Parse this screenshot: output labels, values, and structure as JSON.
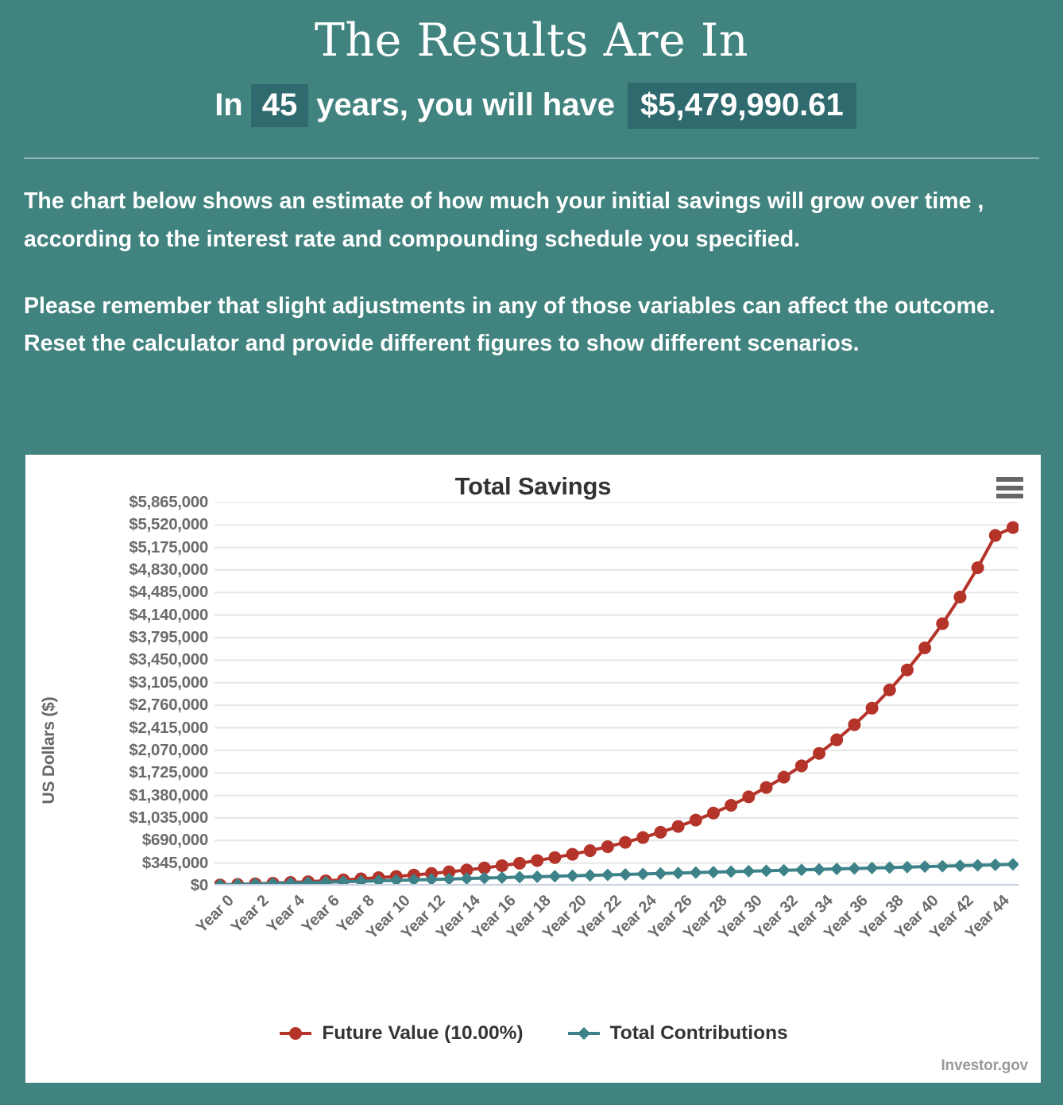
{
  "header": {
    "title": "The Results Are In",
    "in_word": "In",
    "years": "45",
    "years_word": "years, you will have",
    "amount": "$5,479,990.61"
  },
  "body": {
    "paragraph_1": "The chart below shows an estimate of how much your initial savings will grow over time , according to the interest rate and compounding schedule you specified.",
    "paragraph_2": "Please remember that slight adjustments in any of those variables can affect the outcome. Reset the calculator and provide different figures to show different scenarios."
  },
  "chart": {
    "title": "Total Savings",
    "menu_icon": "hamburger-menu-icon",
    "watermark": "Investor.gov"
  },
  "colors": {
    "page_background": "#41837f",
    "highlight_box": "#2f6a6e",
    "future_value": "#b5342a",
    "total_contributions": "#3d8289",
    "gridline": "#e6e6e6",
    "axis_text": "#6b6b6b",
    "card_background": "#ffffff"
  },
  "chart_data": {
    "type": "line",
    "title": "Total Savings",
    "xlabel": "",
    "ylabel": "US Dollars ($)",
    "ylim": [
      0,
      5865000
    ],
    "grid": true,
    "legend_position": "bottom",
    "y_ticks": [
      "$0",
      "$345,000",
      "$690,000",
      "$1,035,000",
      "$1,380,000",
      "$1,725,000",
      "$2,070,000",
      "$2,415,000",
      "$2,760,000",
      "$3,105,000",
      "$3,450,000",
      "$3,795,000",
      "$4,140,000",
      "$4,485,000",
      "$4,830,000",
      "$5,175,000",
      "$5,520,000",
      "$5,865,000"
    ],
    "y_tick_values": [
      0,
      345000,
      690000,
      1035000,
      1380000,
      1725000,
      2070000,
      2415000,
      2760000,
      3105000,
      3450000,
      3795000,
      4140000,
      4485000,
      4830000,
      5175000,
      5520000,
      5865000
    ],
    "x_tick_labels": [
      "Year 0",
      "Year 2",
      "Year 4",
      "Year 6",
      "Year 8",
      "Year 10",
      "Year 12",
      "Year 14",
      "Year 16",
      "Year 18",
      "Year 20",
      "Year 22",
      "Year 24",
      "Year 26",
      "Year 28",
      "Year 30",
      "Year 32",
      "Year 34",
      "Year 36",
      "Year 38",
      "Year 40",
      "Year 42",
      "Year 44"
    ],
    "x": [
      0,
      1,
      2,
      3,
      4,
      5,
      6,
      7,
      8,
      9,
      10,
      11,
      12,
      13,
      14,
      15,
      16,
      17,
      18,
      19,
      20,
      21,
      22,
      23,
      24,
      25,
      26,
      27,
      28,
      29,
      30,
      31,
      32,
      33,
      34,
      35,
      36,
      37,
      38,
      39,
      40,
      41,
      42,
      43,
      44,
      45
    ],
    "series": [
      {
        "name": "Future Value (10.00%)",
        "color": "#b5342a",
        "marker": "circle",
        "values": [
          10000,
          18200,
          27220,
          37142,
          48056,
          60062,
          73268,
          87795,
          103774,
          121352,
          140687,
          161956,
          185351,
          211086,
          239395,
          270535,
          304788,
          342467,
          383914,
          429505,
          479656,
          534821,
          595503,
          662254,
          735679,
          816447,
          905292,
          1003021,
          1110523,
          1228775,
          1358853,
          1501938,
          1659332,
          1832465,
          2022911,
          2232402,
          2462843,
          2716127,
          2994739,
          3301213,
          3638335,
          4009168,
          4417085,
          4865793,
          5359373,
          5479991
        ]
      },
      {
        "name": "Total Contributions",
        "color": "#3d8289",
        "marker": "diamond",
        "values": [
          10000,
          17000,
          24000,
          31000,
          38000,
          45000,
          52000,
          59000,
          66000,
          73000,
          80000,
          87000,
          94000,
          101000,
          108000,
          115000,
          122000,
          129000,
          136000,
          143000,
          150000,
          157000,
          164000,
          171000,
          178000,
          185000,
          192000,
          199000,
          206000,
          213000,
          220000,
          227000,
          234000,
          241000,
          248000,
          255000,
          262000,
          269000,
          276000,
          283000,
          290000,
          297000,
          304000,
          311000,
          318000,
          325000
        ]
      }
    ]
  }
}
